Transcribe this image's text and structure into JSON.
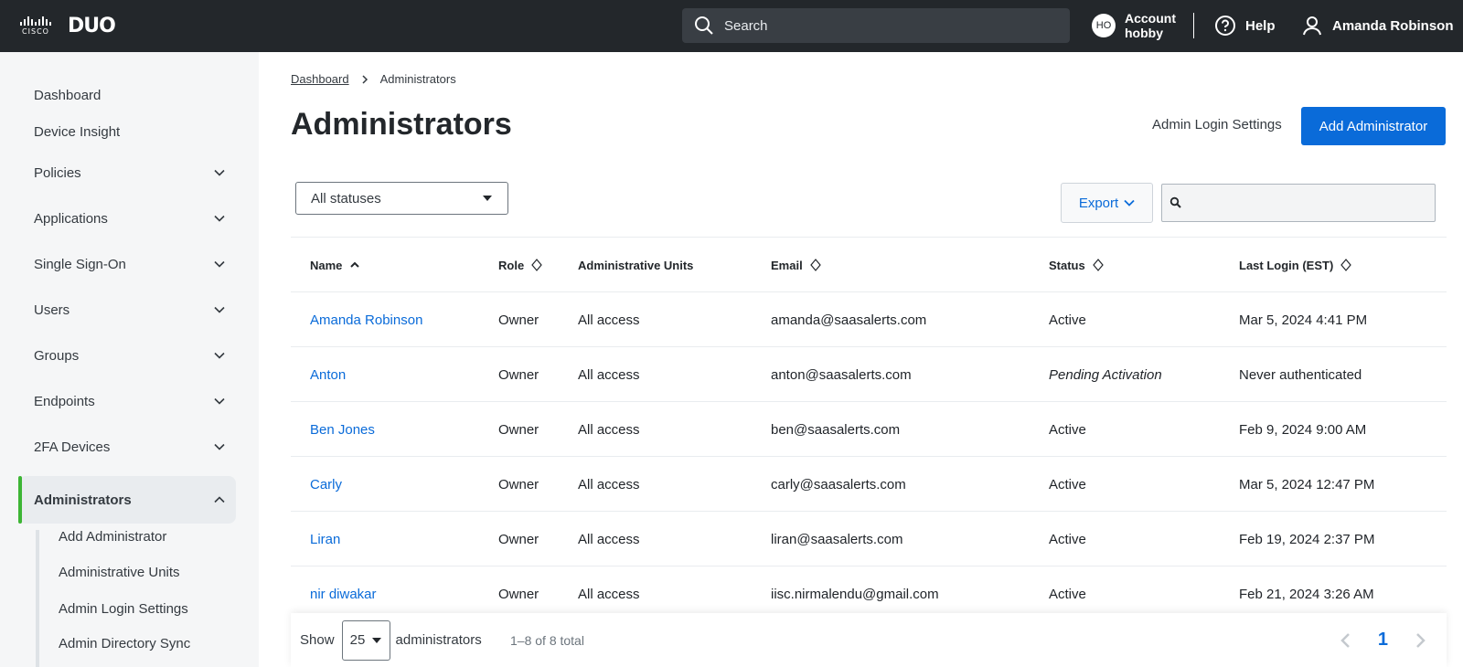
{
  "topbar": {
    "cisco_word": "CISCO",
    "duo_word": "DUO",
    "search_placeholder": "Search",
    "account_initials": "HO",
    "account_line1": "Account",
    "account_line2": "hobby",
    "help_label": "Help",
    "user_name": "Amanda Robinson"
  },
  "sidebar": {
    "items": [
      {
        "label": "Dashboard"
      },
      {
        "label": "Device Insight"
      },
      {
        "label": "Policies"
      },
      {
        "label": "Applications"
      },
      {
        "label": "Single Sign-On"
      },
      {
        "label": "Users"
      },
      {
        "label": "Groups"
      },
      {
        "label": "Endpoints"
      },
      {
        "label": "2FA Devices"
      },
      {
        "label": "Administrators"
      }
    ],
    "sub_items": [
      {
        "label": "Add Administrator"
      },
      {
        "label": "Administrative Units"
      },
      {
        "label": "Admin Login Settings"
      },
      {
        "label": "Admin Directory Sync"
      }
    ]
  },
  "breadcrumb": {
    "parent": "Dashboard",
    "current": "Administrators"
  },
  "page": {
    "title": "Administrators",
    "admin_login_link": "Admin Login Settings",
    "add_button": "Add Administrator",
    "status_filter": "All statuses",
    "export_label": "Export",
    "table_search_placeholder": ""
  },
  "table": {
    "headers": [
      "Name",
      "Role",
      "Administrative Units",
      "Email",
      "Status",
      "Last Login (EST)"
    ],
    "rows": [
      {
        "name": "Amanda Robinson",
        "role": "Owner",
        "units": "All access",
        "email": "amanda@saasalerts.com",
        "status": "Active",
        "last_login": "Mar 5, 2024 4:41 PM"
      },
      {
        "name": "Anton",
        "role": "Owner",
        "units": "All access",
        "email": "anton@saasalerts.com",
        "status": "Pending Activation",
        "last_login": "Never authenticated"
      },
      {
        "name": "Ben Jones",
        "role": "Owner",
        "units": "All access",
        "email": "ben@saasalerts.com",
        "status": "Active",
        "last_login": "Feb 9, 2024 9:00 AM"
      },
      {
        "name": "Carly",
        "role": "Owner",
        "units": "All access",
        "email": "carly@saasalerts.com",
        "status": "Active",
        "last_login": "Mar 5, 2024 12:47 PM"
      },
      {
        "name": "Liran",
        "role": "Owner",
        "units": "All access",
        "email": "liran@saasalerts.com",
        "status": "Active",
        "last_login": "Feb 19, 2024 2:37 PM"
      },
      {
        "name": "nir diwakar",
        "role": "Owner",
        "units": "All access",
        "email": "iisc.nirmalendu@gmail.com",
        "status": "Active",
        "last_login": "Feb 21, 2024 3:26 AM"
      }
    ]
  },
  "footer": {
    "show_label": "Show",
    "page_size": "25",
    "unit_label": "administrators",
    "total_text": "1–8 of 8 total",
    "current_page": "1"
  }
}
